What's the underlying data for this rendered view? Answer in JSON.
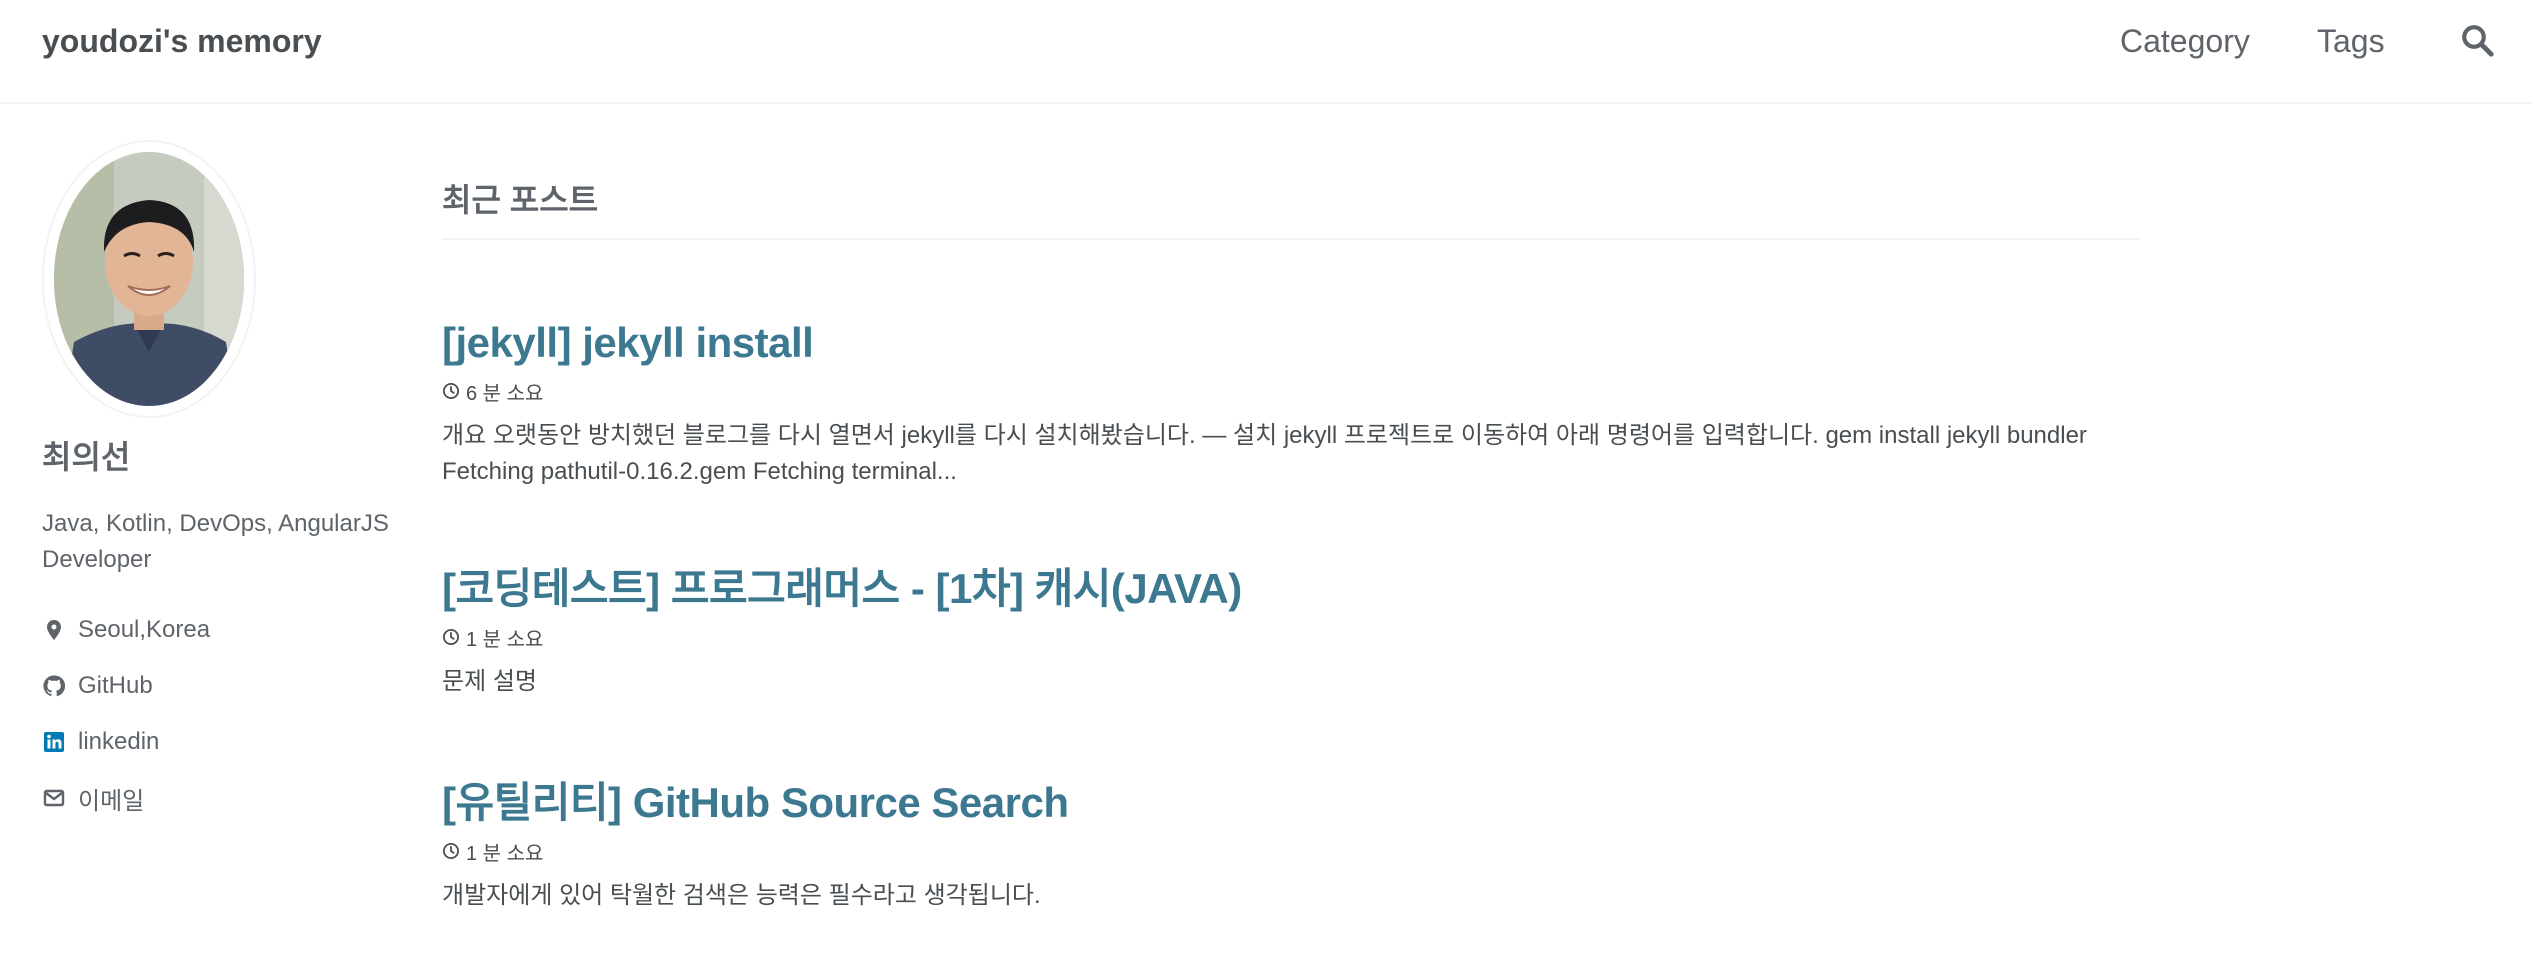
{
  "site": {
    "title": "youdozi's memory"
  },
  "nav": {
    "category": "Category",
    "tags": "Tags",
    "search_icon": "search-icon"
  },
  "author": {
    "name": "최의선",
    "bio": "Java, Kotlin, DevOps, AngularJS Developer",
    "links": [
      {
        "icon": "map-marker-icon",
        "label": "Seoul,Korea"
      },
      {
        "icon": "github-icon",
        "label": "GitHub"
      },
      {
        "icon": "linkedin-icon",
        "label": "linkedin"
      },
      {
        "icon": "envelope-icon",
        "label": "이메일"
      }
    ]
  },
  "main": {
    "subtitle": "최근 포스트",
    "posts": [
      {
        "title": "[jekyll] jekyll install",
        "read_time": "6 분 소요",
        "excerpt": "개요 오랫동안 방치했던 블로그를 다시 열면서 jekyll를 다시 설치해봤습니다. — 설치 jekyll 프로젝트로 이동하여 아래 명령어를 입력합니다. gem install jekyll bundler Fetching pathutil-0.16.2.gem Fetching terminal..."
      },
      {
        "title": "[코딩테스트] 프로그래머스 - [1차] 캐시(JAVA)",
        "read_time": "1 분 소요",
        "excerpt": "문제 설명"
      },
      {
        "title": "[유틸리티] GitHub Source Search",
        "read_time": "1 분 소요",
        "excerpt": "개발자에게 있어 탁월한 검색은 능력은 필수라고 생각됩니다."
      }
    ]
  },
  "colors": {
    "link": "#3c7890",
    "text": "#494e52",
    "linkedin": "#007bb6"
  }
}
